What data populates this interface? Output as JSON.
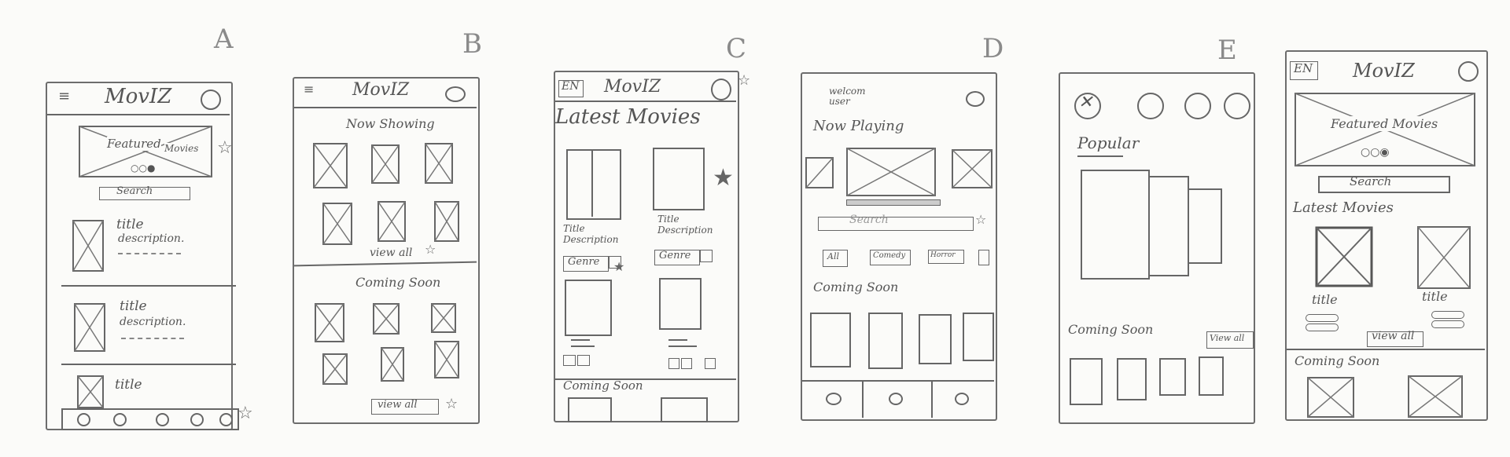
{
  "labels": {
    "a": "A",
    "b": "B",
    "c": "C",
    "d": "D",
    "e": "E"
  },
  "texts": {
    "moviz": "MovIZ",
    "en": "EN",
    "featured": "Featured",
    "movies_small": "Movies",
    "featured_movies": "Featured Movies",
    "search_a": "Search",
    "search": "Search",
    "title": "title",
    "description": "description.",
    "title_cap": "Title",
    "now_showing": "Now Showing",
    "view_all": "view all",
    "coming_soon": "Coming Soon",
    "view_all_button": "view all",
    "latest_movies": "Latest Movies",
    "title_description": "Title Description",
    "genre": "Genre",
    "welcome_user": "welcom user",
    "now_playing": "Now Playing",
    "all": "All",
    "comedy": "Comedy",
    "horror": "Horror",
    "popular": "Popular",
    "view_all_e": "View all",
    "title_f": "title",
    "title_f2": "title"
  }
}
